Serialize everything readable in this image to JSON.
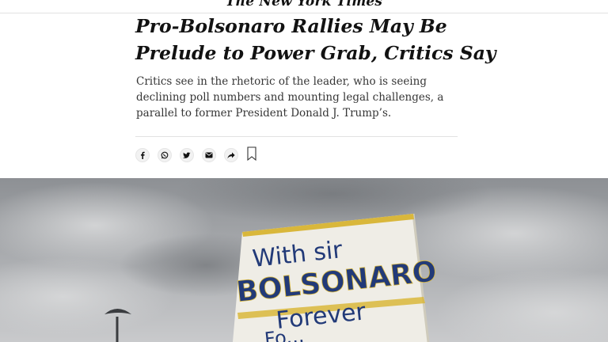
{
  "masthead": {
    "logo_text": "The New York Times"
  },
  "article": {
    "headline": "Pro-Bolsonaro Rallies May Be Prelude to Power Grab, Critics Say",
    "summary": "Critics see in the rhetoric of the leader, who is seeing declining poll numbers and mounting legal challenges, a parallel to former President Donald J. Trump’s."
  },
  "share_bar": {
    "icons": [
      "facebook-icon",
      "whatsapp-icon",
      "twitter-icon",
      "email-icon",
      "share-icon",
      "bookmark-icon"
    ]
  },
  "photo": {
    "banner_lines": [
      "With sir",
      "BOLSONARO",
      "Forever",
      "Fo..."
    ]
  },
  "colors": {
    "text": "#121212",
    "summary_text": "#363636",
    "divider": "#e2e2e2",
    "banner_lettering": "#223a78",
    "banner_stripe": "#d9b73b"
  }
}
